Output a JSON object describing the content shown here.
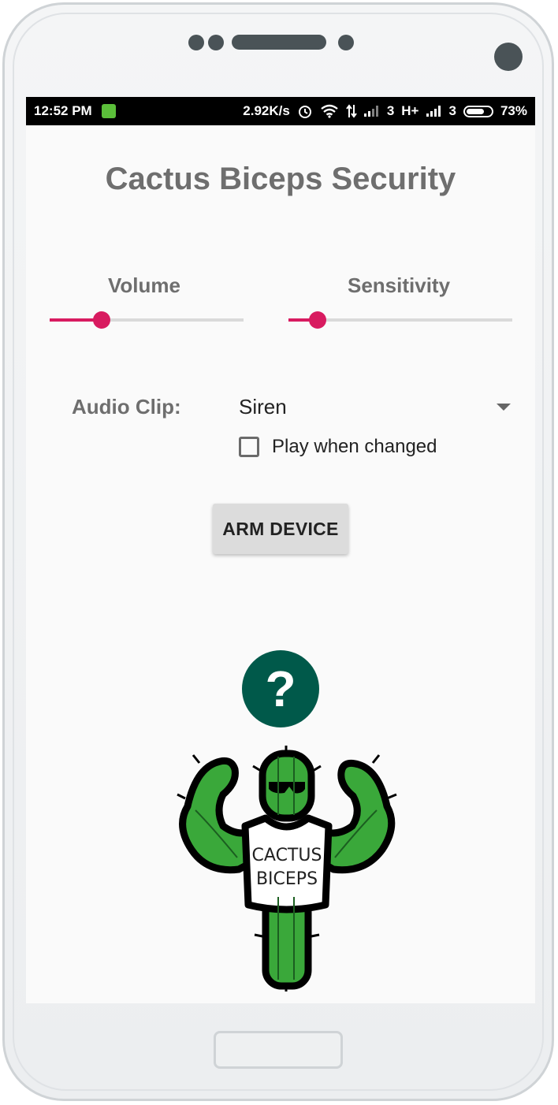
{
  "status_bar": {
    "time": "12:52 PM",
    "speed": "2.92K/s",
    "sim1_label": "3",
    "network_type": "H+",
    "sim2_label": "3",
    "battery": "73%",
    "battery_level": 0.73,
    "icons": [
      "app-notification-icon",
      "alarm-icon",
      "wifi-icon",
      "data-arrows-icon",
      "signal-icon",
      "battery-icon"
    ]
  },
  "app": {
    "title": "Cactus Biceps Security"
  },
  "controls": {
    "volume": {
      "label": "Volume",
      "value": 0.27
    },
    "sensitivity": {
      "label": "Sensitivity",
      "value": 0.13
    },
    "audio_clip_label": "Audio Clip:",
    "audio_clip_value": "Siren",
    "play_when_changed_label": "Play when changed",
    "play_when_changed_checked": false,
    "arm_button_label": "ARM DEVICE"
  },
  "status_icon": {
    "glyph": "?",
    "color": "#00594a"
  },
  "mascot": {
    "text_line1": "CACTUS",
    "text_line2": "BICEPS"
  },
  "colors": {
    "accent": "#d81b60",
    "title_gray": "#6e6e6e"
  }
}
